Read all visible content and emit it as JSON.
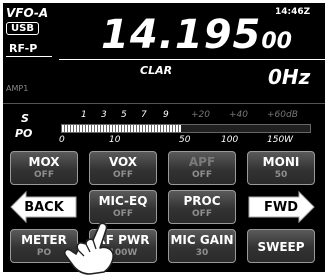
{
  "header": {
    "vfo_label": "VFO-A",
    "mode": "USB",
    "time": "14:46Z",
    "rf_label": "RF-P",
    "frequency_main": "14.195",
    "frequency_small": "00",
    "amp_label": "AMP1",
    "clar_label": "CLAR",
    "clar_offset": "0Hz"
  },
  "meter": {
    "s_label": "S",
    "po_label": "PO",
    "s_scale": [
      "1",
      "3",
      "5",
      "7",
      "9"
    ],
    "s_scale_over": [
      "+20",
      "+40",
      "+60dB"
    ],
    "po_scale": [
      "0",
      "10",
      "50",
      "100",
      "150W"
    ],
    "level_fraction": 0.48
  },
  "buttons": [
    {
      "label": "MOX",
      "sub": "OFF"
    },
    {
      "label": "VOX",
      "sub": "OFF"
    },
    {
      "label": "APF",
      "sub": "OFF"
    },
    {
      "label": "MONI",
      "sub": "50"
    },
    {
      "label": "BACK",
      "sub": ""
    },
    {
      "label": "MIC-EQ",
      "sub": "OFF"
    },
    {
      "label": "PROC",
      "sub": "OFF"
    },
    {
      "label": "FWD",
      "sub": ""
    },
    {
      "label": "METER",
      "sub": "PO"
    },
    {
      "label": "RF PWR",
      "sub": "100W"
    },
    {
      "label": "MIC GAIN",
      "sub": "30"
    },
    {
      "label": "SWEEP",
      "sub": ""
    }
  ],
  "colors": {
    "background": "#000000",
    "text": "#ffffff",
    "button_face": "#3a3a3a",
    "sub_text": "#8e8e8e"
  }
}
